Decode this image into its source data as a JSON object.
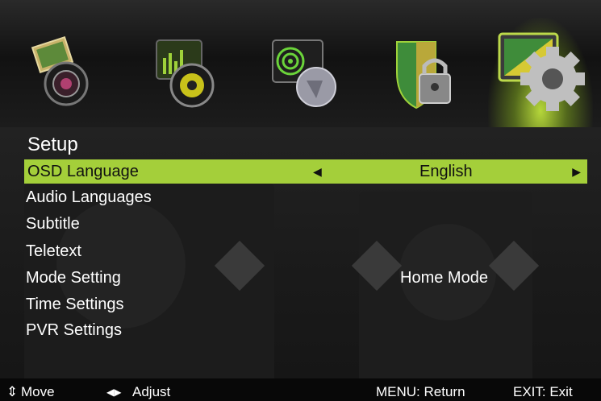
{
  "tabs": [
    {
      "icon": "picture-camera-icon",
      "active": false
    },
    {
      "icon": "sound-speaker-icon",
      "active": false
    },
    {
      "icon": "channel-satellite-icon",
      "active": false
    },
    {
      "icon": "lock-shield-icon",
      "active": false
    },
    {
      "icon": "setup-gear-icon",
      "active": true
    }
  ],
  "menu": {
    "title": "Setup",
    "items": [
      {
        "label": "OSD Language",
        "value": "English",
        "selected": true
      },
      {
        "label": "Audio Languages"
      },
      {
        "label": "Subtitle"
      },
      {
        "label": "Teletext"
      },
      {
        "label": "Mode Setting",
        "value": "Home Mode"
      },
      {
        "label": "Time Settings"
      },
      {
        "label": "PVR Settings"
      }
    ]
  },
  "help": {
    "move": "Move",
    "adjust": "Adjust",
    "menu": "MENU: Return",
    "exit": "EXIT: Exit"
  },
  "colors": {
    "highlight": "#a4cf3a"
  }
}
